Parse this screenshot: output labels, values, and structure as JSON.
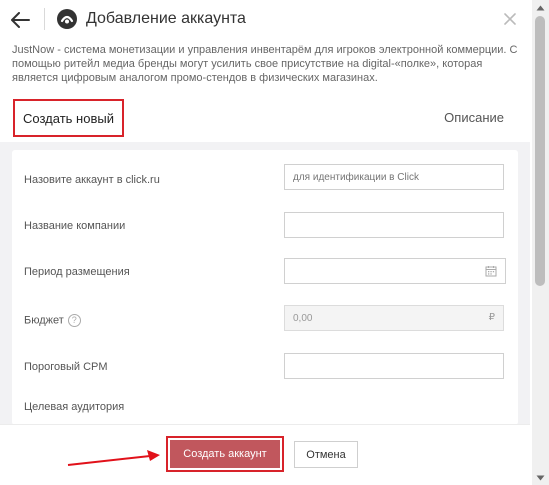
{
  "header": {
    "back_icon": "arrow-left-icon",
    "logo_icon": "brand-logo-icon",
    "title": "Добавление аккаунта",
    "close_icon": "close-icon"
  },
  "description": "JustNow - система монетизации и управления инвентарём для игроков электронной коммерции. С помощью ритейл медиа бренды могут усилить свое присутствие на digital-«полке», которая является цифровым аналогом промо-стендов в физических магазинах.",
  "tabs": [
    {
      "label": "Создать новый",
      "active": true
    },
    {
      "label": "Описание",
      "active": false
    }
  ],
  "form": {
    "account_name": {
      "label": "Назовите аккаунт в click.ru",
      "placeholder": "для идентификации в Click",
      "value": ""
    },
    "company_name": {
      "label": "Название компании",
      "value": ""
    },
    "period": {
      "label": "Период размещения",
      "value": "",
      "icon": "calendar-icon"
    },
    "budget": {
      "label": "Бюджет",
      "help_icon": "question-icon",
      "value": "0,00",
      "currency": "₽",
      "disabled": true
    },
    "threshold_cpm": {
      "label": "Пороговый CPM",
      "value": ""
    },
    "audience": {
      "label": "Целевая аудитория"
    }
  },
  "footer": {
    "submit_label": "Создать аккаунт",
    "cancel_label": "Отмена"
  },
  "colors": {
    "accent_red": "#d8232a",
    "primary_button": "#c1575d",
    "panel_background": "#f2f2f4"
  }
}
